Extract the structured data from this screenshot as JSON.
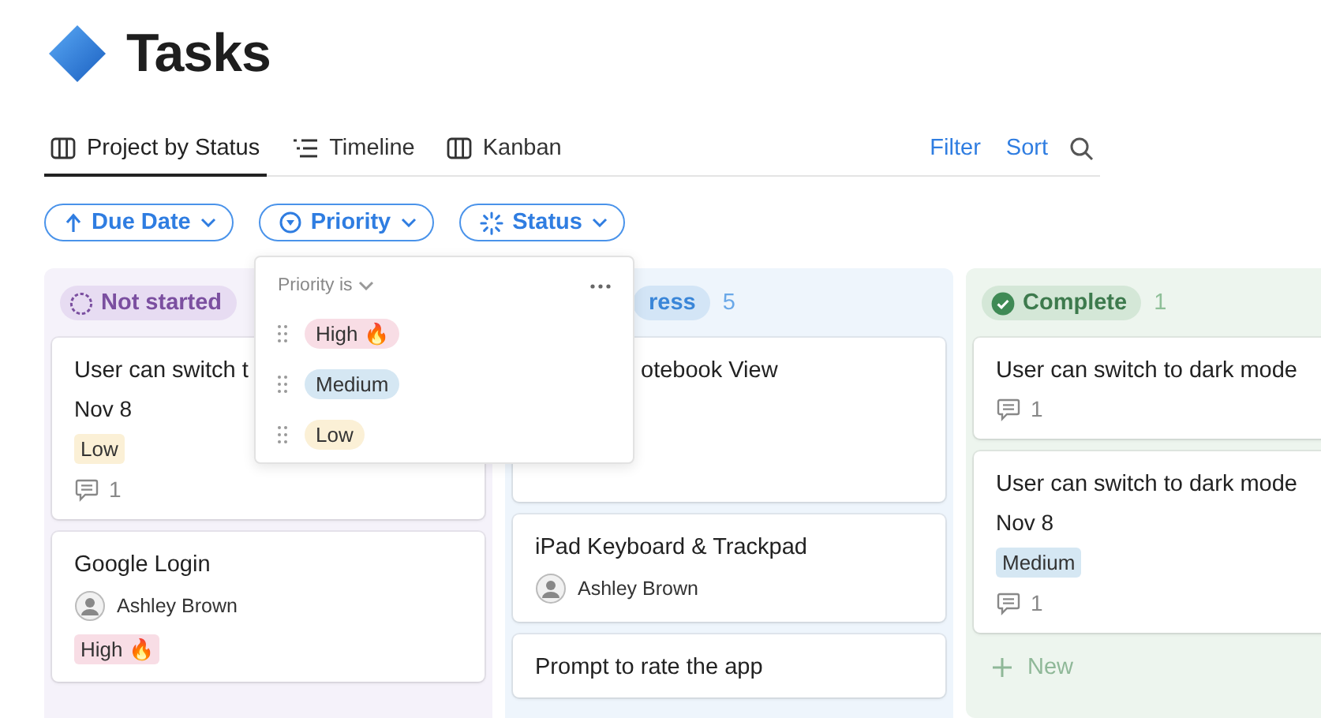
{
  "page": {
    "title": "Tasks"
  },
  "tabs": [
    {
      "label": "Project by Status",
      "selected": true
    },
    {
      "label": "Timeline",
      "selected": false
    },
    {
      "label": "Kanban",
      "selected": false
    }
  ],
  "actions": [
    "Filter",
    "Sort"
  ],
  "filters": [
    {
      "label": "Due Date"
    },
    {
      "label": "Priority"
    },
    {
      "label": "Status"
    }
  ],
  "priority_menu": {
    "heading": "Priority is",
    "options": [
      {
        "label": "High 🔥",
        "color": "#f8dde5"
      },
      {
        "label": "Medium",
        "color": "#d5e7f3"
      },
      {
        "label": "Low",
        "color": "#fbf0d6"
      }
    ]
  },
  "columns": [
    {
      "kind": "not_started",
      "label": "Not started",
      "cards": [
        {
          "title": "User can switch t",
          "date": "Nov 8",
          "tag": {
            "label": "Low",
            "color": "#fbf0d6"
          },
          "comments": "1"
        },
        {
          "title": "Google Login",
          "assignee": "Ashley Brown",
          "tag": {
            "label": "High 🔥",
            "color": "#f8dde5"
          }
        }
      ]
    },
    {
      "kind": "in_progress",
      "label": "ress",
      "count": "5",
      "cards": [
        {
          "title": "otebook View"
        },
        {
          "title": "iPad Keyboard & Trackpad",
          "assignee": "Ashley Brown"
        },
        {
          "title": "Prompt to rate the app"
        }
      ]
    },
    {
      "kind": "complete",
      "label": "Complete",
      "count": "1",
      "cards": [
        {
          "title": "User can switch to dark mode",
          "comments": "1"
        },
        {
          "title": "User can switch to dark mode",
          "date": "Nov 8",
          "tag": {
            "label": "Medium",
            "color": "#d5e7f3"
          },
          "comments": "1"
        }
      ],
      "new_label": "New"
    }
  ]
}
